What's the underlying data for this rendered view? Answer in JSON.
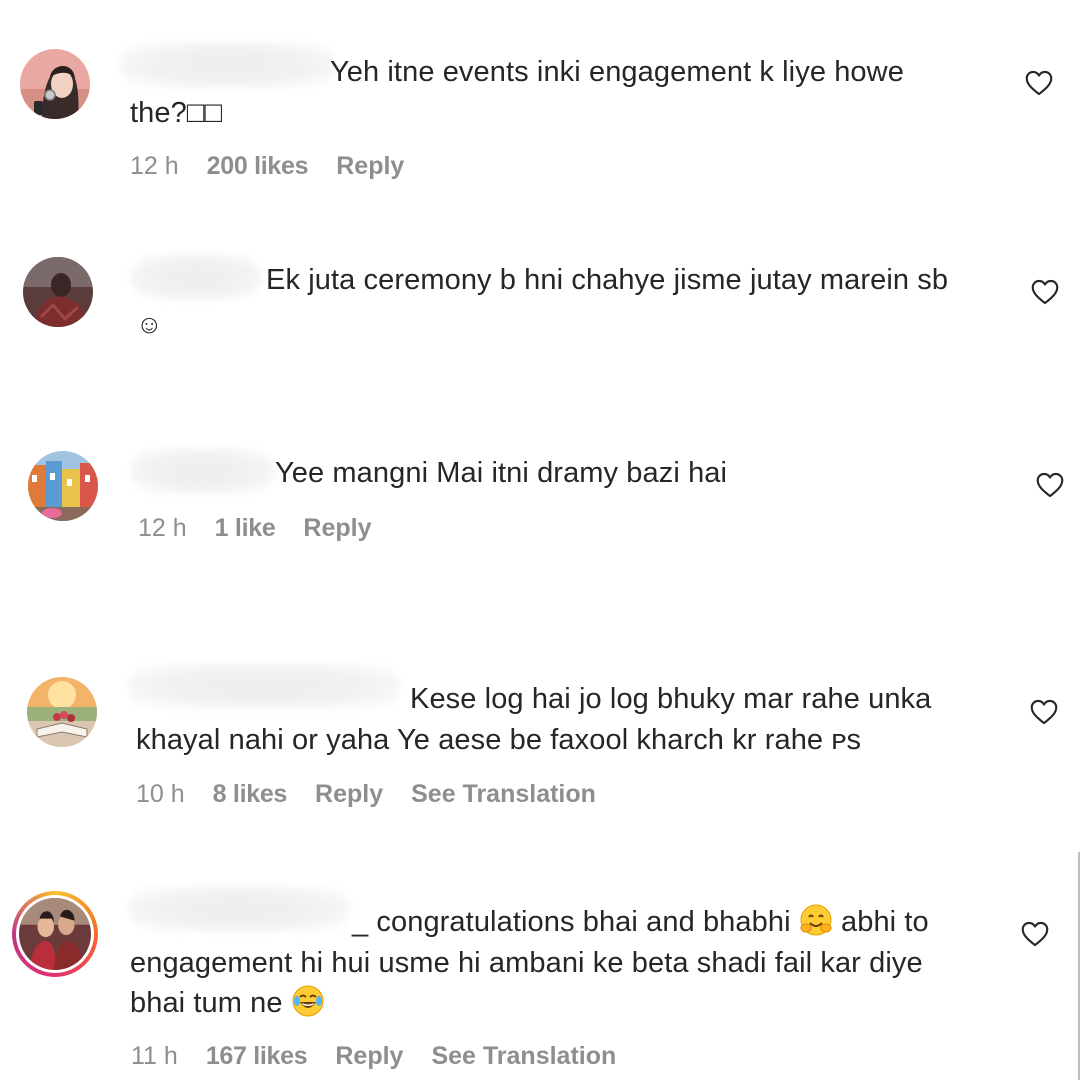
{
  "comments": [
    {
      "text_line1": "Yeh itne events inki engagement k liye howe",
      "text_line2": "the?□□",
      "time": "12 h",
      "likes": "200 likes",
      "reply": "Reply",
      "avatar_icon": "profile-photo-woman-earrings"
    },
    {
      "text_line1": "Ek juta ceremony b hni chahye jisme jutay marein sb",
      "text_line2": "☺",
      "avatar_icon": "profile-photo-dark"
    },
    {
      "text_line1": "Yee mangni Mai itni dramy bazi hai",
      "time": "12 h",
      "likes": "1 like",
      "reply": "Reply",
      "avatar_icon": "profile-photo-colorful-houses"
    },
    {
      "text_line1": "Kese log hai jo log bhuky mar rahe unka",
      "text_line2": "khayal nahi or yaha Ye aese be faxool kharch kr rahe ᴘs",
      "time": "10 h",
      "likes": "8 likes",
      "reply": "Reply",
      "translate": "See Translation",
      "avatar_icon": "profile-photo-book-flowers"
    },
    {
      "text_line1_a": "_ congratulations bhai and bhabhi",
      "text_line1_b": "abhi to",
      "text_line2": "engagement hi hui usme hi ambani ke beta shadi fail kar diye",
      "text_line3": "bhai tum ne",
      "time": "11 h",
      "likes": "167 likes",
      "reply": "Reply",
      "translate": "See Translation",
      "avatar_icon": "profile-photo-couple-story-ring",
      "emoji_1": "hugging-face-emoji",
      "emoji_2": "tears-of-joy-emoji"
    }
  ],
  "icons": {
    "like": "heart-outline-icon"
  },
  "colors": {
    "text": "#262626",
    "meta": "#8e8e8e",
    "background": "#ffffff"
  }
}
